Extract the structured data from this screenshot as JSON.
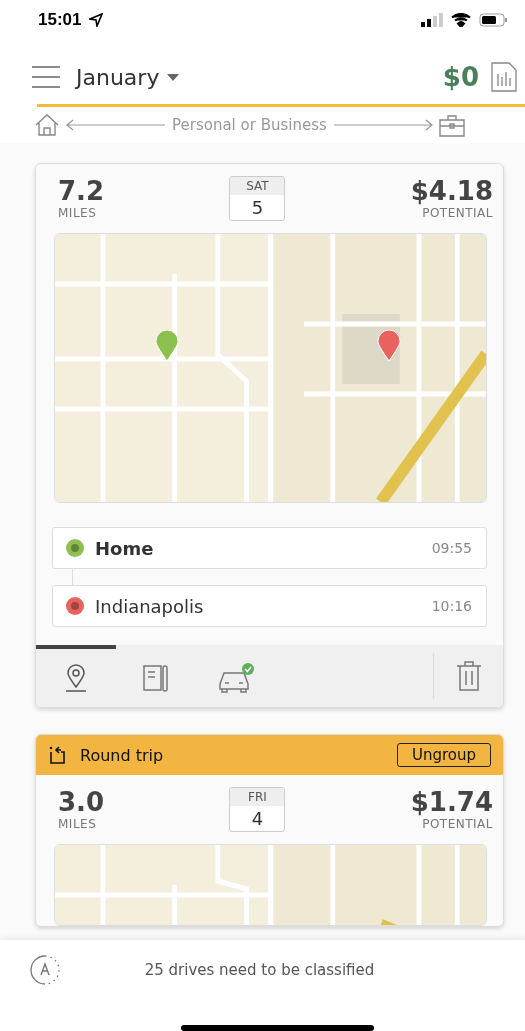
{
  "status_bar": {
    "time": "15:01"
  },
  "header": {
    "month": "January",
    "total": "$0"
  },
  "classify_bar": {
    "label": "Personal or Business"
  },
  "drives": [
    {
      "kind": "single",
      "miles": "7.2",
      "miles_label": "MILES",
      "weekday": "SAT",
      "day": "5",
      "amount": "$4.18",
      "amount_label": "POTENTIAL",
      "map": {
        "kind": "picture"
      },
      "stops": [
        {
          "name": "Home",
          "time": "09:55",
          "color": "#8cc152"
        },
        {
          "name": "Indianapolis",
          "time": "10:16",
          "color": "#e8625e"
        }
      ],
      "tabs": [
        {
          "kind": "pin",
          "selected": true
        },
        {
          "kind": "notes",
          "selected": false
        },
        {
          "kind": "car",
          "selected": false
        }
      ]
    },
    {
      "kind": "round_trip",
      "group_label": "Round trip",
      "group_action": "Ungroup",
      "miles": "3.0",
      "miles_label": "MILES",
      "weekday": "FRI",
      "day": "4",
      "amount": "$1.74",
      "amount_label": "POTENTIAL",
      "map": {
        "kind": "picture"
      }
    }
  ],
  "footer": {
    "message": "25 drives need to be classified"
  }
}
